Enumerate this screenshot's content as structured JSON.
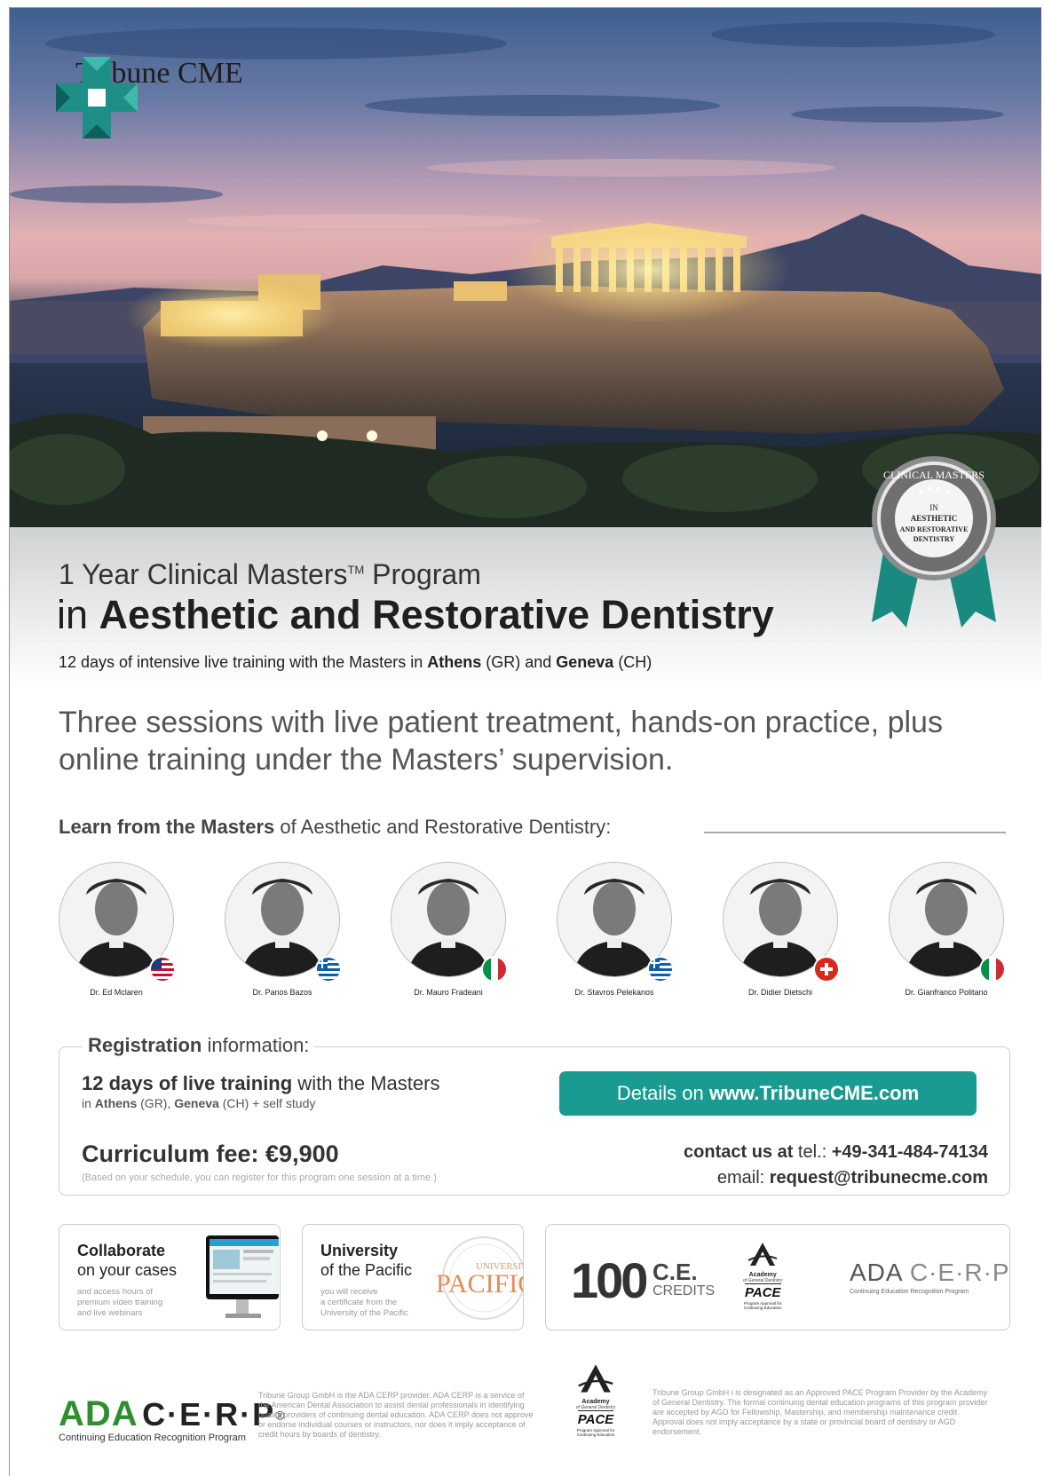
{
  "brand": {
    "name": "Tribune CME"
  },
  "seal": {
    "top": "CLINICAL MASTERS",
    "l1": "IN",
    "l2": "AESTHETIC",
    "l3": "AND RESTORATIVE",
    "l4": "DENTISTRY"
  },
  "program": {
    "kicker_main": "1 Year Clinical Masters",
    "kicker_tm": "TM",
    "kicker_end": " Program",
    "headline_in": "in ",
    "headline_bold": "Aesthetic and Restorative Dentistry",
    "sub_pre": "12 days of intensive live training with the Masters in ",
    "sub_city1": "Athens",
    "sub_c1": " (GR) and ",
    "sub_city2": "Geneva",
    "sub_c2": " (CH)"
  },
  "lead": "Three sessions with live patient treatment, hands-on practice, plus online training under the Masters’ supervision.",
  "learn": {
    "bold": "Learn from the Masters",
    "rest": " of Aesthetic and Restorative Dentistry:"
  },
  "masters": [
    {
      "name": "Dr. Ed Mclaren",
      "flag": "us"
    },
    {
      "name": "Dr. Panos Bazos",
      "flag": "gr"
    },
    {
      "name": "Dr. Mauro Fradeani",
      "flag": "it"
    },
    {
      "name": "Dr. Stavros Pelekanos",
      "flag": "gr"
    },
    {
      "name": "Dr. Didier Dietschi",
      "flag": "ch"
    },
    {
      "name": "Dr. Gianfranco Politano",
      "flag": "it"
    }
  ],
  "registration": {
    "label_bold": "Registration",
    "label_rest": " information:",
    "days_bold": "12 days of live training",
    "days_rest": " with the Masters",
    "days_sub_pre": "in ",
    "days_sub_c1": "Athens",
    "days_sub_mid": " (GR), ",
    "days_sub_c2": "Geneva",
    "days_sub_end": " (CH) + self study",
    "fee": "Curriculum fee: €9,900",
    "fee_note": "(Based on your schedule, you can register for this program one session at a time.)",
    "details_pre": "Details on ",
    "details_url": "www.TribuneCME.com",
    "contact_bold": "contact us at",
    "tel_label": " tel.: ",
    "tel": "+49-341-484-74134",
    "email_label": "email: ",
    "email": "request@tribunecme.com"
  },
  "features": {
    "collab_title1": "Collaborate",
    "collab_title2": "on your cases",
    "collab_small": [
      "and access hours of",
      "premium video training",
      "and live webinars"
    ],
    "uni_title1": "University",
    "uni_title2": "of the Pacific",
    "uni_small": [
      "you will receive",
      "a certificate from the",
      "University of the Pacific"
    ],
    "uni_seal_top": "UNIVERSITY OF",
    "uni_seal_word": "PACIFIC",
    "credits_num": "100",
    "credits_ce": "C.E.",
    "credits_label": "CREDITS"
  },
  "ada": {
    "ada": "ADA",
    "cerp": "C·E·R·P",
    "reg": "®",
    "tagline": "Continuing Education Recognition Program"
  },
  "pace": {
    "academy": "Academy",
    "agd": "of General Dentistry",
    "pace": "PACE",
    "t1": "Program Approval for",
    "t2": "Continuing Education"
  },
  "fineprint": {
    "ada": "Tribune Group GmbH is the ADA CERP provider. ADA CERP is a service of the American Dental Association to assist dental professionals in identifying quality providers of continuing dental education. ADA CERP does not approve or endorse individual courses or instructors, nor does it imply acceptance of credit hours by boards of dentistry.",
    "pace": "Tribune Group GmbH i is designated as an Approved PACE Program Provider by the Academy of General Dentistry. The formal continuing dental education programs of this program provider are accepted by AGD for Fellowship, Mastership, and membership maintenance credit. Approval does not imply acceptance by a state or provincial board of dentistry or AGD endorsement."
  },
  "colors": {
    "teal": "#1a9b91",
    "ada_green": "#2f8f2f",
    "text_dark": "#222222"
  }
}
